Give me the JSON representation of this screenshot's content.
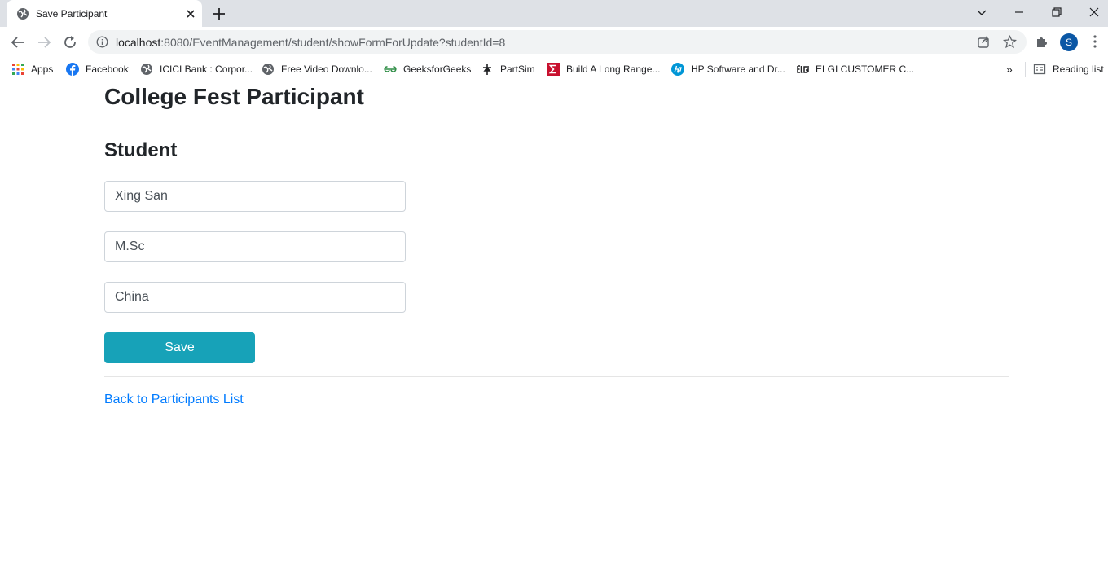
{
  "browser": {
    "tab_title": "Save Participant",
    "url_host": "localhost",
    "url_path": ":8080/EventManagement/student/showFormForUpdate?studentId=8",
    "profile_initial": "S"
  },
  "bookmarks": {
    "items": [
      {
        "label": "Apps",
        "icon": "apps-grid-icon"
      },
      {
        "label": "Facebook",
        "icon": "facebook-icon"
      },
      {
        "label": "ICICI Bank : Corpor...",
        "icon": "globe-icon"
      },
      {
        "label": "Free Video Downlo...",
        "icon": "globe-icon"
      },
      {
        "label": "GeeksforGeeks",
        "icon": "geeksforgeeks-icon"
      },
      {
        "label": "PartSim",
        "icon": "partsim-icon"
      },
      {
        "label": "Build A Long Range...",
        "icon": "sigma-icon"
      },
      {
        "label": "HP Software and Dr...",
        "icon": "hp-icon"
      },
      {
        "label": "ELGI CUSTOMER C...",
        "icon": "elgi-icon"
      }
    ],
    "overflow_label": "»",
    "reading_list_label": "Reading list"
  },
  "page": {
    "title": "College Fest Participant",
    "subtitle": "Student",
    "fields": [
      {
        "value": "Xing San"
      },
      {
        "value": "M.Sc"
      },
      {
        "value": "China"
      }
    ],
    "save_label": "Save",
    "back_link_label": "Back to Participants List"
  },
  "colors": {
    "save_button": "#17a2b8",
    "link": "#007bff",
    "avatar": "#0b57a5"
  }
}
